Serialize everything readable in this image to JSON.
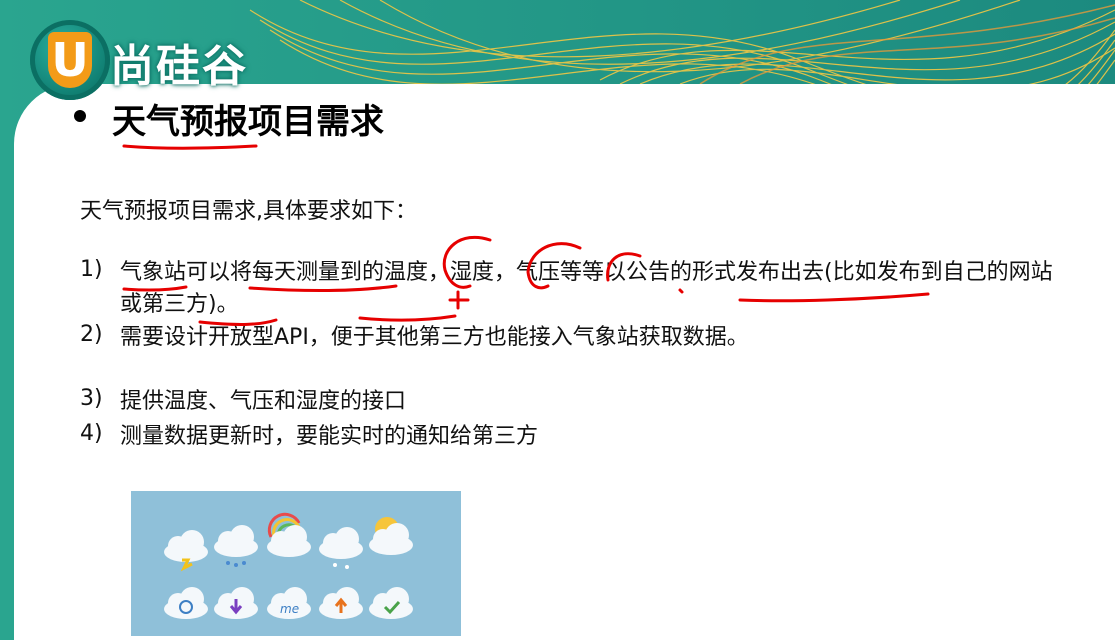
{
  "logo": {
    "letter": "U",
    "name": "尚硅谷"
  },
  "slide": {
    "title": "天气预报项目需求",
    "intro": "天气预报项目需求,具体要求如下：",
    "requirements": [
      {
        "num": "1)",
        "text": "气象站可以将每天测量到的温度，湿度，气压等等以公告的形式发布出去(比如发布到自己的网站或第三方)。"
      },
      {
        "num": "2)",
        "text": "需要设计开放型API，便于其他第三方也能接入气象站获取数据。"
      },
      {
        "num": "3)",
        "text": "提供温度、气压和湿度的接口"
      },
      {
        "num": "4)",
        "text": "测量数据更新时，要能实时的通知给第三方"
      }
    ]
  },
  "weather_icons": {
    "row1": [
      "cloud-lightning-icon",
      "cloud-rain-icon",
      "cloud-rainbow-icon",
      "cloud-snow-icon",
      "cloud-sun-icon"
    ],
    "row2": [
      "cloud-refresh-icon",
      "cloud-download-icon",
      "cloud-me-icon",
      "cloud-upload-icon",
      "cloud-check-icon"
    ],
    "me_label": "me"
  },
  "colors": {
    "teal": "#1f8f84",
    "gold": "#f2b632",
    "annotation_red": "#e60000",
    "logo_orange": "#f39b18"
  }
}
